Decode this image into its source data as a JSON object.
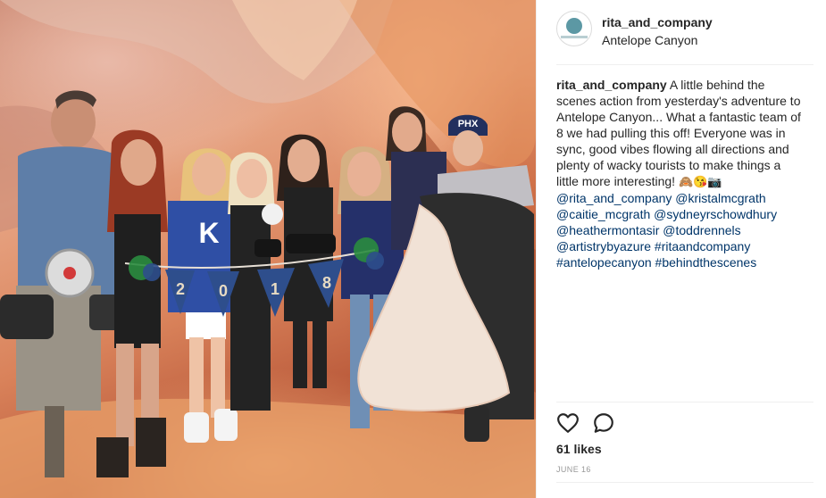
{
  "post": {
    "username": "rita_and_company",
    "location": "Antelope Canyon",
    "caption": {
      "username": "rita_and_company",
      "text_before": " A little behind the scenes action from yesterday's adventure to Antelope Canyon... What a fantastic team of 8 we had pulling this off! Everyone was in sync, good vibes flowing all directions and plenty of wacky tourists to make things a little more interesting! ",
      "emojis": "🙈😘📷",
      "mentions": [
        "@rita_and_company",
        "@kristalmcgrath",
        "@caitie_mcgrath",
        "@sydneyrschowdhury",
        "@heathermontasir",
        "@toddrennels",
        "@artistrybyazure"
      ],
      "hashtags": [
        "#ritaandcompany",
        "#antelopecanyon",
        "#behindthescenes"
      ]
    },
    "likes": "61 likes",
    "date": "JUNE 16"
  },
  "photo": {
    "banner_text": "2018",
    "cap_text": "PHX",
    "jacket_letter": "K"
  },
  "icons": {
    "like": "heart-outline-icon",
    "comment": "speech-bubble-icon"
  },
  "colors": {
    "link": "#003569",
    "text": "#262626",
    "muted": "#999999",
    "banner_blue": "#2e4e8c",
    "banner_green": "#2a8c3f",
    "avatar_teal": "#5c98a4"
  }
}
